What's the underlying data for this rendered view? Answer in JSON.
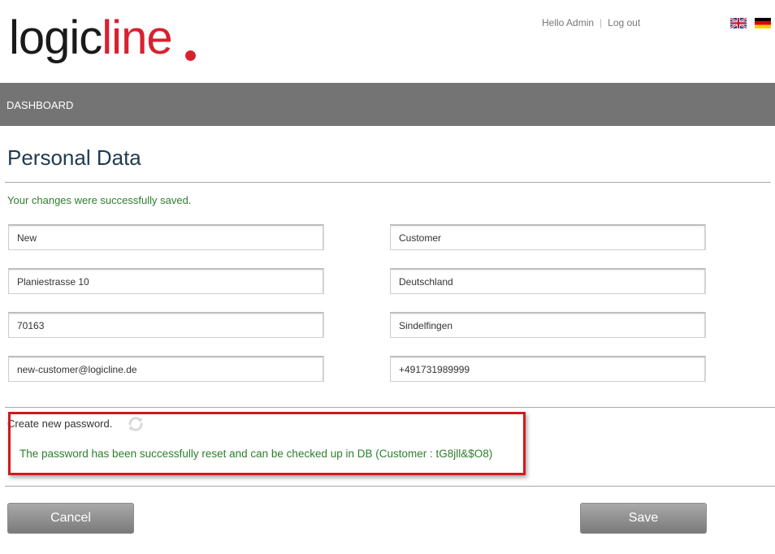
{
  "brand": {
    "part1": "logic",
    "part2": "line",
    "accent_color": "#d7212f"
  },
  "userbar": {
    "greeting": "Hello Admin",
    "separator": "|",
    "logout": "Log out"
  },
  "languages": [
    {
      "icon": "uk-flag-icon",
      "code": "en"
    },
    {
      "icon": "de-flag-icon",
      "code": "de"
    }
  ],
  "nav": {
    "dashboard": "DASHBOARD",
    "bg_color": "#747474"
  },
  "page": {
    "title": "Personal Data",
    "success_message": "Your changes were successfully saved."
  },
  "form": {
    "first_name": "New",
    "last_name": "Customer",
    "street": "Planiestrasse 10",
    "country": "Deutschland",
    "zip": "70163",
    "city": "Sindelfingen",
    "email": "new-customer@logicline.de",
    "phone": "+491731989999"
  },
  "password": {
    "label": "Create new password.",
    "refresh_icon": "refresh-icon",
    "reset_message": "The password has been successfully reset and can be checked up in DB (Customer : tG8jll&$O8)"
  },
  "buttons": {
    "cancel": "Cancel",
    "save": "Save"
  },
  "colors": {
    "success": "#2e7d2e",
    "title": "#1f3b52",
    "highlight": "#d4181d"
  }
}
